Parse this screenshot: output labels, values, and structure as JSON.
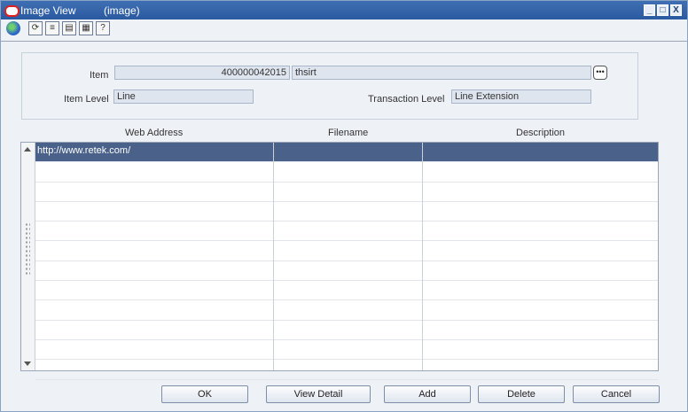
{
  "window": {
    "title": "Image View",
    "subtitle": "(image)",
    "controls": [
      "_",
      "□",
      "X"
    ]
  },
  "toolbar": {
    "icons": [
      "globe-icon",
      "refresh-icon",
      "options-icon",
      "clipboard-icon",
      "print-icon",
      "help-icon"
    ]
  },
  "header": {
    "item_label": "Item",
    "item_number": "400000042015",
    "item_desc": "thsirt",
    "item_level_label": "Item Level",
    "item_level_value": "Line",
    "transaction_level_label": "Transaction Level",
    "transaction_level_value": "Line Extension"
  },
  "table": {
    "columns": [
      "Web Address",
      "Filename",
      "Description"
    ],
    "rows": [
      {
        "web_address": "http://www.retek.com/",
        "filename": "",
        "description": ""
      },
      {
        "web_address": "",
        "filename": "",
        "description": ""
      },
      {
        "web_address": "",
        "filename": "",
        "description": ""
      },
      {
        "web_address": "",
        "filename": "",
        "description": ""
      },
      {
        "web_address": "",
        "filename": "",
        "description": ""
      },
      {
        "web_address": "",
        "filename": "",
        "description": ""
      },
      {
        "web_address": "",
        "filename": "",
        "description": ""
      },
      {
        "web_address": "",
        "filename": "",
        "description": ""
      },
      {
        "web_address": "",
        "filename": "",
        "description": ""
      },
      {
        "web_address": "",
        "filename": "",
        "description": ""
      },
      {
        "web_address": "",
        "filename": "",
        "description": ""
      },
      {
        "web_address": "",
        "filename": "",
        "description": ""
      }
    ]
  },
  "buttons": {
    "ok": "OK",
    "view_detail": "View Detail",
    "add": "Add",
    "delete": "Delete",
    "cancel": "Cancel"
  },
  "colors": {
    "selected_row": "#4a6189",
    "titlebar": "#2b5aa0"
  }
}
